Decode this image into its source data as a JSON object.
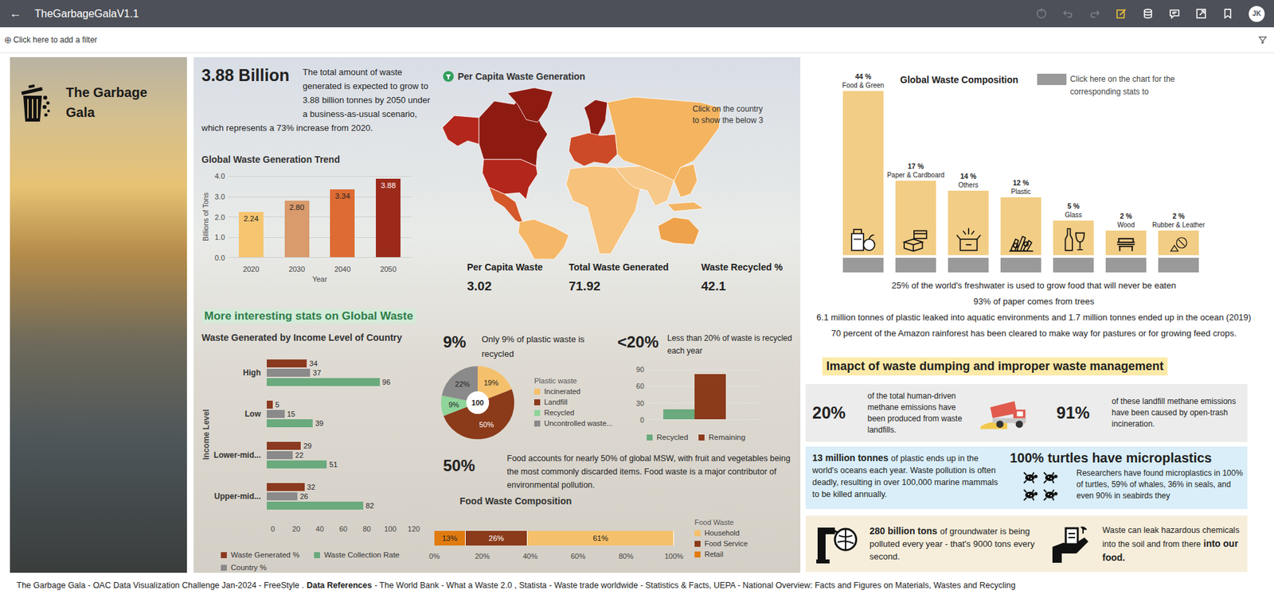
{
  "app": {
    "back": "←",
    "title": "TheGarbageGalaV1.1",
    "avatar": "JK",
    "toolbar": [
      {
        "disabled": true,
        "selected": false
      },
      {
        "disabled": true,
        "selected": false
      },
      {
        "disabled": true,
        "selected": false
      },
      {
        "disabled": false,
        "selected": true
      },
      {
        "disabled": false,
        "selected": false
      },
      {
        "disabled": false,
        "selected": false
      },
      {
        "disabled": false,
        "selected": false
      },
      {
        "disabled": false,
        "selected": false
      }
    ]
  },
  "filter": {
    "icon": "⊕",
    "text": "Click here to add a filter"
  },
  "hero": {
    "title": "The Garbage Gala"
  },
  "headline": {
    "value": "3.88 Billion",
    "text": "The total amount of waste generated is expected to grow to 3.88 billion tonnes by 2050 under a business-as-usual scenario, which represents a 73% increase from 2020."
  },
  "trend": {
    "title": "Global Waste Generation Trend",
    "y_title": "Billions of Tons",
    "x_title": "Year",
    "y_ticks": [
      "4.0",
      "3.0",
      "2.0",
      "1.0",
      "0.0"
    ],
    "y_max": 4,
    "categories": [
      "2020",
      "2030",
      "2040",
      "2050"
    ],
    "values": [
      2.24,
      2.8,
      3.34,
      3.88
    ],
    "value_labels": [
      "2.24",
      "2.80",
      "3.34",
      "3.88"
    ],
    "colors": [
      "#f6c56f",
      "#d99a6c",
      "#dd6b33",
      "#9b2a1a"
    ]
  },
  "map": {
    "title": "Per Capita Waste Generation",
    "hint": "Click on the country to show the below 3",
    "regions": [
      {
        "color": "#b3261b"
      },
      {
        "color": "#8e1b12"
      },
      {
        "color": "#8e1b12"
      },
      {
        "color": "#b3261b"
      },
      {
        "color": "#d4582a"
      },
      {
        "color": "#f5b768"
      },
      {
        "color": "#8e1b12"
      },
      {
        "color": "#cc4a27"
      },
      {
        "color": "#f7c27c"
      },
      {
        "color": "#f4b460"
      },
      {
        "color": "#f7c98a"
      },
      {
        "color": "#f3b563"
      },
      {
        "color": "#eea24b"
      }
    ]
  },
  "kpis": [
    {
      "label": "Per Capita Waste",
      "value": "3.02"
    },
    {
      "label": "Total Waste Generated",
      "value": "71.92"
    },
    {
      "label": "Waste Recycled %",
      "value": "42.1"
    }
  ],
  "section_title": "More interesting stats on Global Waste",
  "income": {
    "title": "Waste Generated by Income Level of Country",
    "y_title": "Income Level",
    "categories": [
      "High",
      "Low",
      "Lower-mid...",
      "Upper-mid..."
    ],
    "x_ticks": [
      "0",
      "20",
      "40",
      "60",
      "80",
      "100",
      "120"
    ],
    "x_max": 120,
    "series": [
      {
        "name": "Waste Generated %",
        "color": "#8b3a1f",
        "values": [
          34,
          5,
          29,
          32
        ],
        "labels": [
          "34",
          "5",
          "29",
          "32"
        ]
      },
      {
        "name": "Country %",
        "color": "#8a8a8a",
        "values": [
          37,
          15,
          22,
          26
        ],
        "labels": [
          "37",
          "15",
          "22",
          "26"
        ]
      },
      {
        "name": "Waste Collection Rate",
        "color": "#6aaa7d",
        "values": [
          96,
          39,
          51,
          82
        ],
        "labels": [
          "96",
          "39",
          "51",
          "82"
        ]
      }
    ]
  },
  "plastic": {
    "big": "9%",
    "text": "Only 9% of plastic waste is recycled",
    "center": "100",
    "legend_title": "Plastic waste",
    "segments": [
      {
        "name": "Incinerated",
        "value": 19,
        "label": "19%",
        "color": "#f5c06b"
      },
      {
        "name": "Landfill",
        "value": 50,
        "label": "50%",
        "color": "#8b3a1a"
      },
      {
        "name": "Recycled",
        "value": 9,
        "label": "9%",
        "color": "#8fd49a"
      },
      {
        "name": "Uncontrolled waste...",
        "value": 22,
        "label": "22%",
        "color": "#8a8a8a"
      }
    ]
  },
  "recycling": {
    "big": "<20%",
    "text": "Less than 20% of waste is recycled each year",
    "y_ticks": [
      "90",
      "60",
      "30",
      "0"
    ],
    "y_max": 90,
    "series": [
      {
        "name": "Recycled",
        "value": 18,
        "color": "#6aaa7d"
      },
      {
        "name": "Remaining",
        "value": 82,
        "color": "#8b3a1a"
      }
    ]
  },
  "food": {
    "big": "50%",
    "text": "Food accounts for nearly 50% of global MSW, with fruit and vegetables being the most commonly discarded items. Food waste is a major contributor of environmental pollution.",
    "title": "Food Waste Composition",
    "x_ticks": [
      "0%",
      "20%",
      "40%",
      "60%",
      "80%",
      "100%"
    ],
    "legend_title": "Food Waste",
    "segments": [
      {
        "name": "Retail",
        "value": 13,
        "label": "13%",
        "color": "#e07b10"
      },
      {
        "name": "Food Service",
        "value": 26,
        "label": "26%",
        "color": "#8b3a1a"
      },
      {
        "name": "Household",
        "value": 61,
        "label": "61%",
        "color": "#f5c06b"
      }
    ]
  },
  "composition": {
    "title": "Global Waste Composition",
    "hint": "Click here on the chart for the corresponding stats to",
    "items": [
      {
        "pct": "44 %",
        "label": "Food & Green",
        "value": 44
      },
      {
        "pct": "17 %",
        "label": "Paper & Cardboard",
        "value": 17
      },
      {
        "pct": "14 %",
        "label": "Others",
        "value": 14
      },
      {
        "pct": "12 %",
        "label": "Plastic",
        "value": 12
      },
      {
        "pct": "5 %",
        "label": "Glass",
        "value": 5
      },
      {
        "pct": "2 %",
        "label": "Wood",
        "value": 2
      },
      {
        "pct": "2 %",
        "label": "Rubber & Leather",
        "value": 2
      }
    ]
  },
  "facts": [
    "25% of the world's freshwater is used to grow food that will never be eaten",
    "93% of paper comes from trees",
    "6.1 million tonnes of plastic leaked into aquatic environments and 1.7 million tonnes ended up in the ocean (2019)",
    "70 percent of the Amazon rainforest has been cleared to make way for pastures or for growing feed crops."
  ],
  "impact": {
    "title": "Imapct of waste dumping and improper waste management",
    "methane": [
      {
        "big": "20%",
        "text": "of the total human-driven methane emissions have been produced from waste landfills."
      },
      {
        "big": "91%",
        "text": "of these landfill methane emissions have been caused by open-trash incineration."
      }
    ],
    "ocean": {
      "bold": "13 million tonnes",
      "text": "of plastic ends up in the world's oceans each year. Waste pollution is often deadly, resulting in over 100,000 marine mammals to be killed annually."
    },
    "turtles": {
      "title": "100% turtles have microplastics",
      "text": "Researchers have found microplastics in 100% of turtles, 59% of whales, 36% in seals, and even 90% in seabirds they"
    },
    "groundwater": {
      "bold": "280 billion tons",
      "text": "of groundwater is being polluted every year - that's 9000 tons every second."
    },
    "chemicals": {
      "text": "Waste can leak hazardous chemicals into the soil and from there",
      "bold": "into our food."
    }
  },
  "footer": [
    {
      "text": "The Garbage Gala - OAC Data Visualization Challenge Jan-2024 - FreeStyle .",
      "bold": false
    },
    {
      "text": "Data References",
      "bold": true
    },
    {
      "text": "- The World Bank - What a Waste 2.0 , Statista - Waste trade worldwide - Statistics & Facts, UEPA - National Overview: Facts and Figures on Materials, Wastes and Recycling",
      "bold": false
    }
  ]
}
